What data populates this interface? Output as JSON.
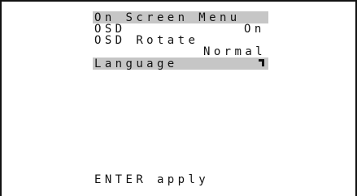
{
  "menu": {
    "title": "On Screen Menu",
    "osd_label": "OSD",
    "osd_value": "On",
    "rotate_label": "OSD Rotate",
    "rotate_value": "Normal",
    "language_label": "Language",
    "footer": "ENTER apply",
    "highlight_color": "#c6c6c6",
    "submenu_icon": "corner-arrow-icon"
  }
}
